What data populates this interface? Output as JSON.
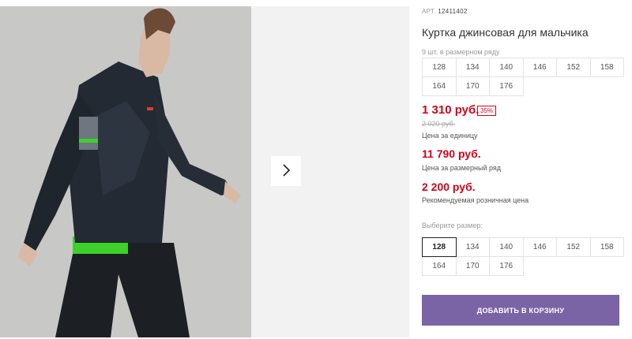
{
  "product": {
    "article_label": "АРТ.",
    "article_value": "12411402",
    "title": "Куртка джинсовая для мальчика",
    "sizes_hint": "9 шт. в размерном ряду",
    "size_row": [
      "128",
      "134",
      "140",
      "146",
      "152",
      "158",
      "164",
      "170",
      "176"
    ]
  },
  "pricing": {
    "unit_price": "1 310 руб.",
    "discount": "35%",
    "old_price": "2 020 руб.",
    "unit_caption": "Цена за единицу",
    "row_price": "11 790 руб.",
    "row_caption": "Цена за размерный ряд",
    "retail_price": "2 200 руб.",
    "retail_caption": "Рекомендуемая розничная цена"
  },
  "size_select": {
    "label": "Выберите размер:",
    "options": [
      "128",
      "134",
      "140",
      "146",
      "152",
      "158",
      "164",
      "170",
      "176"
    ],
    "selected": "128"
  },
  "cart": {
    "button_label": "ДОБАВИТЬ В КОРЗИНУ"
  },
  "gallery": {
    "next_icon": "chevron-right-icon"
  },
  "colors": {
    "accent": "#7b64a5",
    "price": "#d0021b"
  }
}
